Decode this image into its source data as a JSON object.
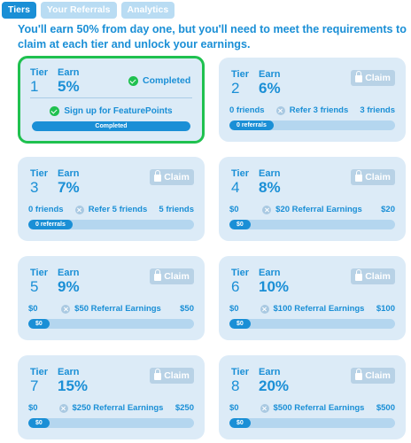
{
  "tabs": [
    {
      "label": "Tiers",
      "active": true
    },
    {
      "label": "Your Referrals",
      "active": false
    },
    {
      "label": "Analytics",
      "active": false
    }
  ],
  "intro": "You'll earn 50% from day one, but you'll need to meet the requirements to claim at each tier and unlock your earnings.",
  "labels": {
    "tier": "Tier",
    "earn": "Earn",
    "claim": "Claim",
    "completed": "Completed"
  },
  "colors": {
    "accent": "#1a8fd6",
    "completed_border": "#1fc14f",
    "card_bg": "#dcebf7",
    "claim_disabled": "#b8d2e6"
  },
  "tiers": [
    {
      "tier": "1",
      "earn": "5%",
      "status": "completed",
      "requirement": "Sign up for FeaturePoints",
      "bar_label": "Completed",
      "progress": 1.0
    },
    {
      "tier": "2",
      "earn": "6%",
      "status": "locked",
      "left": "0 friends",
      "requirement": "Refer 3 friends",
      "right": "3 friends",
      "bar_label": "0 referrals",
      "progress": 0
    },
    {
      "tier": "3",
      "earn": "7%",
      "status": "locked",
      "left": "0 friends",
      "requirement": "Refer 5 friends",
      "right": "5 friends",
      "bar_label": "0 referrals",
      "progress": 0
    },
    {
      "tier": "4",
      "earn": "8%",
      "status": "locked",
      "left": "$0",
      "requirement": "$20 Referral Earnings",
      "right": "$20",
      "bar_label": "$0",
      "progress": 0
    },
    {
      "tier": "5",
      "earn": "9%",
      "status": "locked",
      "left": "$0",
      "requirement": "$50 Referral Earnings",
      "right": "$50",
      "bar_label": "$0",
      "progress": 0
    },
    {
      "tier": "6",
      "earn": "10%",
      "status": "locked",
      "left": "$0",
      "requirement": "$100 Referral Earnings",
      "right": "$100",
      "bar_label": "$0",
      "progress": 0
    },
    {
      "tier": "7",
      "earn": "15%",
      "status": "locked",
      "left": "$0",
      "requirement": "$250 Referral Earnings",
      "right": "$250",
      "bar_label": "$0",
      "progress": 0
    },
    {
      "tier": "8",
      "earn": "20%",
      "status": "locked",
      "left": "$0",
      "requirement": "$500 Referral Earnings",
      "right": "$500",
      "bar_label": "$0",
      "progress": 0
    }
  ]
}
